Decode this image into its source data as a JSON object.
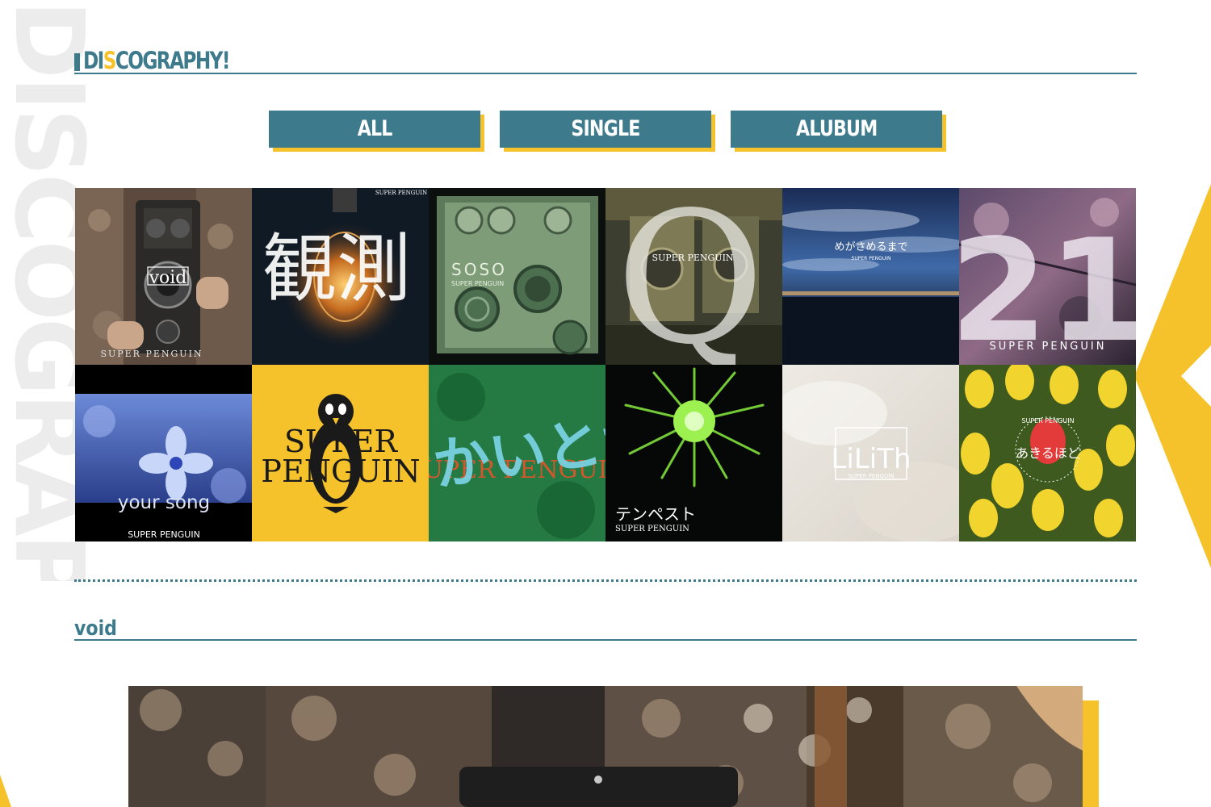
{
  "background_text": "DISCOGRAPHY",
  "section": {
    "title_prefix": "DI",
    "title_highlight": "S",
    "title_suffix": "COGRAPHY!"
  },
  "filters": [
    {
      "label": "ALL"
    },
    {
      "label": "SINGLE"
    },
    {
      "label": "ALUBUM"
    }
  ],
  "releases": [
    {
      "art_texts": [
        "void",
        "SUPER PENGUIN"
      ]
    },
    {
      "art_texts": [
        "観測",
        "SUPER PENGUIN"
      ]
    },
    {
      "art_texts": [
        "SOSO",
        "SUPER PENGUIN"
      ]
    },
    {
      "art_texts": [
        "Q",
        "SUPER PENGUIN"
      ]
    },
    {
      "art_texts": [
        "めがさめるまで",
        "SUPER PENGUIN"
      ]
    },
    {
      "art_texts": [
        "21",
        "SUPER PENGUIN"
      ]
    },
    {
      "art_texts": [
        "your song",
        "SUPER PENGUIN"
      ]
    },
    {
      "art_texts": [
        "SUPER",
        "PENGUIN"
      ]
    },
    {
      "art_texts": [
        "せかいとか",
        "SUPER PENGUIN"
      ]
    },
    {
      "art_texts": [
        "テンペスト",
        "SUPER PENGUIN"
      ]
    },
    {
      "art_texts": [
        "LiLiTh",
        "SUPER PENGUIN"
      ]
    },
    {
      "art_texts": [
        "あきるほど",
        "SUPER PENGUIN"
      ]
    }
  ],
  "selected": {
    "title": "void"
  },
  "colors": {
    "teal": "#3d7a8c",
    "yellow": "#f6c22b",
    "background_text": "#ececec"
  }
}
